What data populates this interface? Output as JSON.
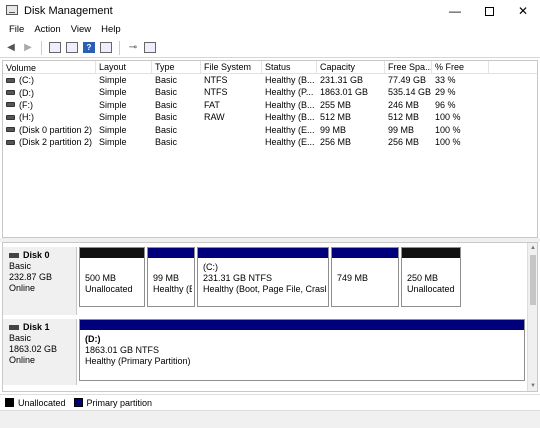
{
  "window": {
    "title": "Disk Management"
  },
  "menu": [
    "File",
    "Action",
    "View",
    "Help"
  ],
  "columns": [
    "Volume",
    "Layout",
    "Type",
    "File System",
    "Status",
    "Capacity",
    "Free Spa...",
    "% Free"
  ],
  "volumes": [
    {
      "volume": "(C:)",
      "layout": "Simple",
      "type": "Basic",
      "fs": "NTFS",
      "status": "Healthy (B...",
      "capacity": "231.31 GB",
      "free": "77.49 GB",
      "pct": "33 %"
    },
    {
      "volume": "(D:)",
      "layout": "Simple",
      "type": "Basic",
      "fs": "NTFS",
      "status": "Healthy (P...",
      "capacity": "1863.01 GB",
      "free": "535.14 GB",
      "pct": "29 %"
    },
    {
      "volume": "(F:)",
      "layout": "Simple",
      "type": "Basic",
      "fs": "FAT",
      "status": "Healthy (B...",
      "capacity": "255 MB",
      "free": "246 MB",
      "pct": "96 %"
    },
    {
      "volume": "(H:)",
      "layout": "Simple",
      "type": "Basic",
      "fs": "RAW",
      "status": "Healthy (B...",
      "capacity": "512 MB",
      "free": "512 MB",
      "pct": "100 %"
    },
    {
      "volume": "(Disk 0 partition 2)",
      "layout": "Simple",
      "type": "Basic",
      "fs": "",
      "status": "Healthy (E...",
      "capacity": "99 MB",
      "free": "99 MB",
      "pct": "100 %"
    },
    {
      "volume": "(Disk 2 partition 2)",
      "layout": "Simple",
      "type": "Basic",
      "fs": "",
      "status": "Healthy (E...",
      "capacity": "256 MB",
      "free": "256 MB",
      "pct": "100 %"
    }
  ],
  "disks": [
    {
      "name": "Disk 0",
      "type": "Basic",
      "size": "232.87 GB",
      "state": "Online",
      "partitions": [
        {
          "bar": "black",
          "title": "",
          "line1": "500 MB",
          "line2": "Unallocated"
        },
        {
          "bar": "navy",
          "title": "",
          "line1": "99 MB",
          "line2": "Healthy (E"
        },
        {
          "bar": "navy",
          "title": "(C:)",
          "line1": "231.31 GB NTFS",
          "line2": "Healthy (Boot, Page File, Crash D"
        },
        {
          "bar": "navy",
          "title": "",
          "line1": "749 MB",
          "line2": ""
        },
        {
          "bar": "black",
          "title": "",
          "line1": "250 MB",
          "line2": "Unallocated"
        }
      ]
    },
    {
      "name": "Disk 1",
      "type": "Basic",
      "size": "1863.02 GB",
      "state": "Online",
      "partitions": [
        {
          "bar": "navy",
          "title": "(D:)",
          "line1": "1863.01 GB NTFS",
          "line2": "Healthy (Primary Partition)"
        }
      ]
    }
  ],
  "legend": [
    {
      "color": "#000000",
      "label": "Unallocated"
    },
    {
      "color": "#00007a",
      "label": "Primary partition"
    }
  ]
}
